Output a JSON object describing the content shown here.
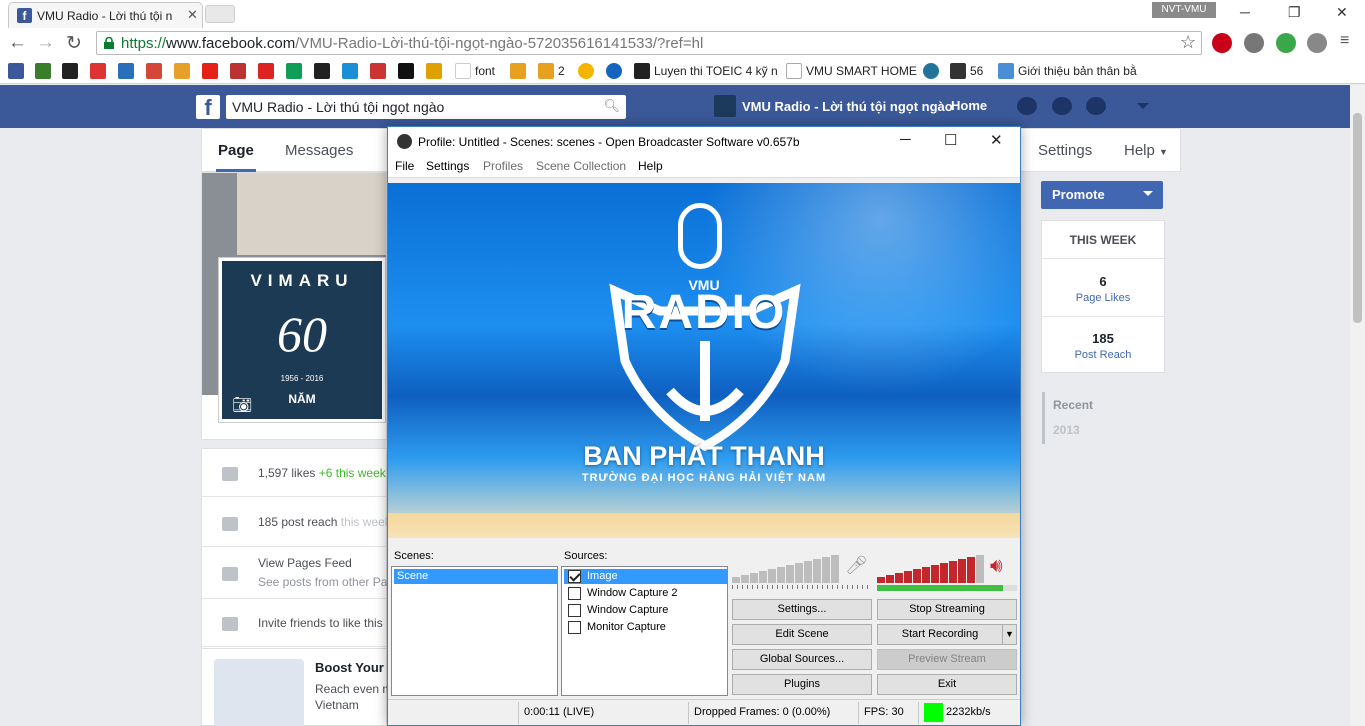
{
  "browser": {
    "tab_title": "VMU Radio - Lời thú tội n",
    "user": "NVT-VMU",
    "url_scheme": "https://",
    "url_host": "www.facebook.com",
    "url_path": "/VMU-Radio-Lời-thú-tội-ngọt-ngào-572035616141533/?ref=hl",
    "bookmarks": [
      "font",
      "2",
      "Luyen thi TOEIC 4 kỹ n",
      "VMU SMART HOME",
      "56",
      "Giới thiệu bản thân bằ"
    ]
  },
  "facebook": {
    "search_value": "VMU Radio - Lời thú tội ngọt ngào",
    "page_name": "VMU Radio - Lời thú tội ngọt ngào",
    "home": "Home",
    "nav": {
      "page": "Page",
      "messages": "Messages",
      "settings": "Settings",
      "help": "Help"
    },
    "profile": {
      "top": "VIMARU",
      "big": "60",
      "years": "1956 - 2016",
      "bottom": "NĂM"
    },
    "stats": {
      "likes": "1,597 likes",
      "likes_delta": "+6 this week",
      "reach": "185 post reach",
      "reach_sub": "this week",
      "feed": "View Pages Feed",
      "feed_sub": "See posts from other Pa",
      "invite": "Invite friends to like this"
    },
    "boost": {
      "title": "Boost Your",
      "line1": "Reach even m",
      "line2": "Vietnam"
    },
    "promote": "Promote",
    "this_week": "THIS WEEK",
    "page_likes_count": "6",
    "page_likes_label": "Page Likes",
    "post_reach_count": "185",
    "post_reach_label": "Post Reach",
    "recent": "Recent",
    "year": "2013"
  },
  "obs": {
    "title": "Profile: Untitled - Scenes: scenes - Open Broadcaster Software v0.657b",
    "menu": [
      "File",
      "Settings",
      "Profiles",
      "Scene Collection",
      "Help"
    ],
    "preview": {
      "logo_small": "VMU",
      "logo_big": "RADIO",
      "banner": "BAN PHÁT THANH",
      "subbanner": "TRƯỜNG ĐẠI HỌC HÀNG HẢI VIỆT NAM"
    },
    "scenes_label": "Scenes:",
    "scenes": [
      "Scene"
    ],
    "sources_label": "Sources:",
    "sources": [
      {
        "name": "Image",
        "checked": true
      },
      {
        "name": "Window Capture 2",
        "checked": false
      },
      {
        "name": "Window Capture",
        "checked": false
      },
      {
        "name": "Monitor Capture",
        "checked": false
      }
    ],
    "mic_level": 0.0,
    "desktop_level": 0.9,
    "buttons": {
      "settings": "Settings...",
      "stop_streaming": "Stop Streaming",
      "edit_scene": "Edit Scene",
      "start_recording": "Start Recording",
      "global_sources": "Global Sources...",
      "preview_stream": "Preview Stream",
      "plugins": "Plugins",
      "exit": "Exit"
    },
    "status": {
      "time": "0:00:11 (LIVE)",
      "dropped": "Dropped Frames: 0 (0.00%)",
      "fps": "FPS: 30",
      "bitrate": "2232kb/s",
      "bitrate_color": "#00ff00"
    },
    "meter_color": "#c1272d"
  }
}
